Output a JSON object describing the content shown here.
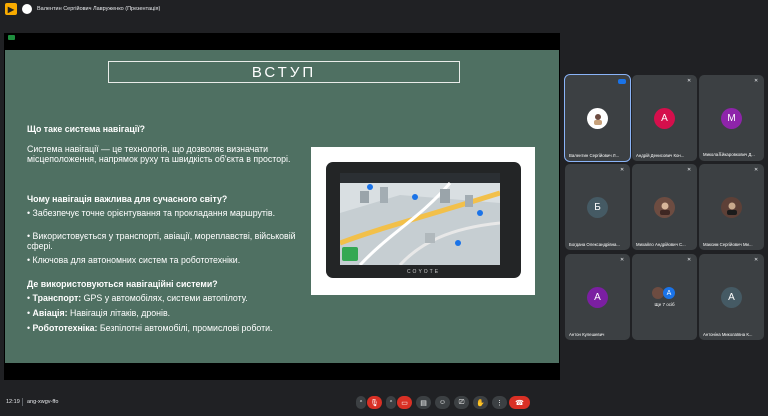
{
  "window": {
    "presenter_label": "Валентин Сергійович Лавруженко (Презентація)"
  },
  "slide": {
    "title": "ВСТУП",
    "q1_heading": "Що таке система навігації?",
    "q1_body": "Система навігації — це технологія, що дозволяє визначати місцеположення, напрямок руху та швидкість об'єкта в просторі.",
    "q2_heading": "Чому навігація важлива для сучасного світу?",
    "q2_bullets": [
      "• Забезпечує точне орієнтування та прокладання маршрутів.",
      "• Використовується у транспорті, авіації, мореплавстві, військовій сфері.",
      "• Ключова для автономних систем та робототехніки."
    ],
    "q3_heading": "Де використовуються навігаційні системи?",
    "q3_bullets": [
      {
        "term": "Транспорт:",
        "text": " GPS у автомобілях, системи автопілоту."
      },
      {
        "term": "Авіація:",
        "text": " Навігація літаків, дронів."
      },
      {
        "term": "Робототехніка:",
        "text": " Безпілотні автомобілі, промислові роботи."
      }
    ],
    "device_brand": "COYOTE"
  },
  "participants": [
    {
      "name": "Валентин Сергійович Л...",
      "initial": "",
      "color": "#ffffff",
      "active": true
    },
    {
      "name": "Андрій Денисович Кон...",
      "initial": "А",
      "color": "#d50f4c"
    },
    {
      "name": "Микола포йкаровкович Д...",
      "initial": "М",
      "color": "#8e24aa"
    },
    {
      "name": "Богдана Олександрівна...",
      "initial": "Б",
      "color": "#455a64"
    },
    {
      "name": "Михайло Андрійович С...",
      "initial": "",
      "color": "#6d4c41"
    },
    {
      "name": "Максим Сергійович Ми...",
      "initial": "",
      "color": "#5d4037"
    },
    {
      "name": "Антон Кулешевич",
      "initial": "А",
      "color": "#7b1fa2"
    },
    {
      "name": "Ще 7 осіб",
      "initial": "А",
      "color": "#1a73e8"
    },
    {
      "name": "Антоніна Миколаївна К...",
      "initial": "А",
      "color": "#455a64"
    }
  ],
  "bottombar": {
    "time": "12:19",
    "meeting_code": "ang-xwgv-ffo"
  }
}
